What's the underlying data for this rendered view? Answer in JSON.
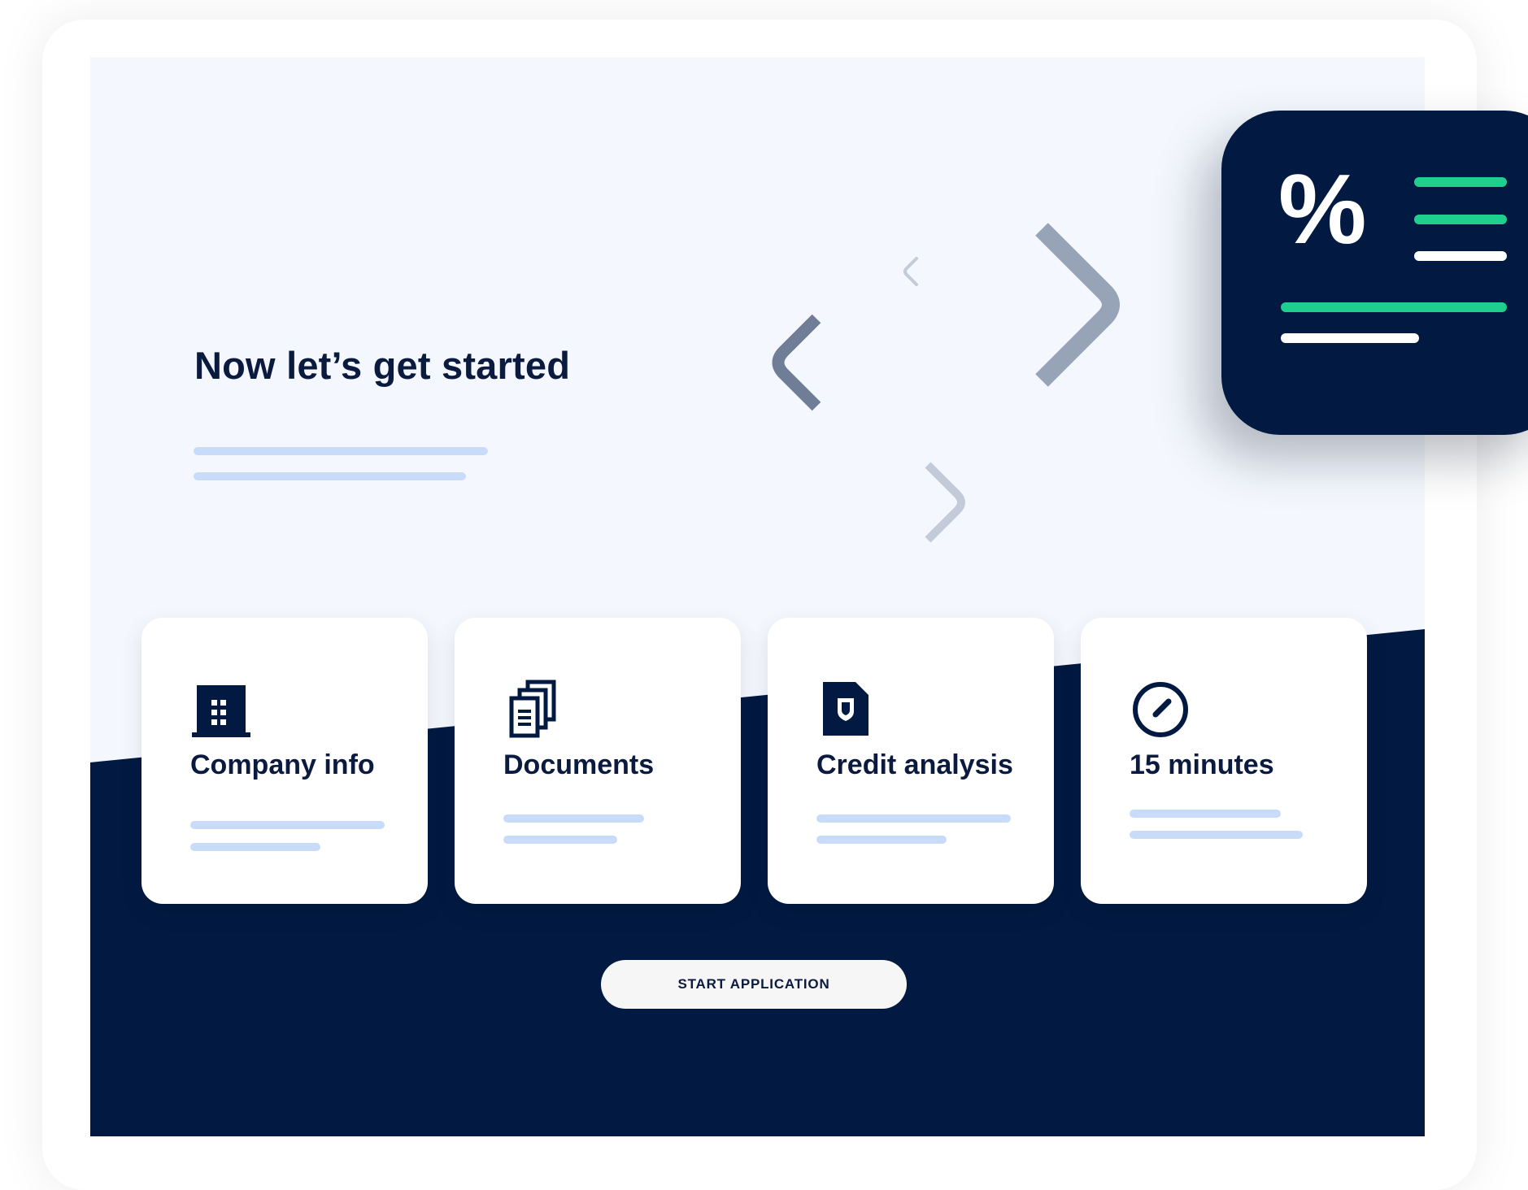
{
  "hero": {
    "title": "Now let’s get started"
  },
  "steps": [
    {
      "icon": "building-icon",
      "title": "Company info"
    },
    {
      "icon": "documents-icon",
      "title": "Documents"
    },
    {
      "icon": "shield-document-icon",
      "title": "Credit analysis"
    },
    {
      "icon": "stopwatch-icon",
      "title": "15 minutes"
    }
  ],
  "cta": {
    "label": "START APPLICATION"
  },
  "rate_card": {
    "symbol": "%",
    "icon": "percent-icon"
  },
  "colors": {
    "navy": "#021a42",
    "page_background": "#f4f8fe",
    "placeholder_line": "#c8dcfa",
    "accent_green": "#1fcf8e"
  }
}
